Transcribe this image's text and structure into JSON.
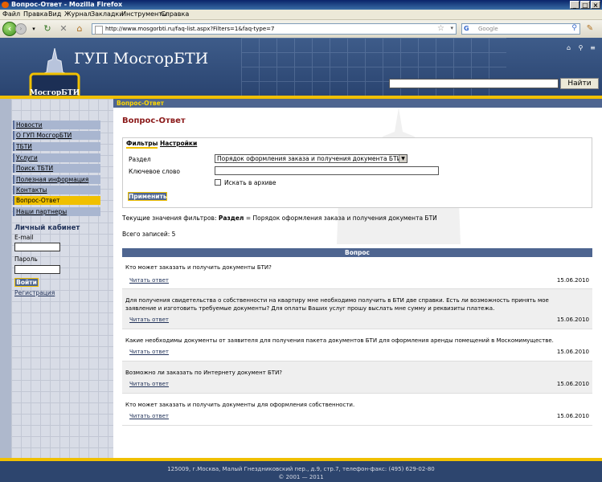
{
  "window": {
    "title": "Вопрос-Ответ - Mozilla Firefox",
    "buttons": [
      "_",
      "□",
      "×"
    ]
  },
  "menu": [
    "Файл",
    "Правка",
    "Вид",
    "Журнал",
    "Закладки",
    "Инструменты",
    "Справка"
  ],
  "browser": {
    "url": "http://www.mosgorbti.ru/faq-list.aspx?Filters=1&faq-type=7",
    "search_placeholder": "Google",
    "search_engine_icon": "G"
  },
  "site": {
    "title": "ГУП МосгорБТИ",
    "emblem_text": "МосгорБТИ",
    "search_button": "Найти"
  },
  "breadcrumb": "Вопрос-Ответ",
  "sidebar": {
    "items": [
      {
        "label": "Новости",
        "active": false
      },
      {
        "label": "О ГУП МосгорБТИ",
        "active": false
      },
      {
        "label": "ТБТИ",
        "active": false
      },
      {
        "label": "Услуги",
        "active": false
      },
      {
        "label": "Поиск ТБТИ",
        "active": false
      },
      {
        "label": "Полезная информация",
        "active": false
      },
      {
        "label": "Контакты",
        "active": false
      },
      {
        "label": "Вопрос-Ответ",
        "active": true
      },
      {
        "label": "Наши партнеры",
        "active": false
      }
    ],
    "cabinet_title": "Личный кабинет",
    "email_label": "E-mail",
    "password_label": "Пароль",
    "login_button": "Войти",
    "register_link": "Регистрация"
  },
  "main": {
    "page_title": "Вопрос-Ответ",
    "tabs": [
      "Фильтры",
      "Настройки"
    ],
    "filters": {
      "section_label": "Раздел",
      "section_value": "Порядок оформления заказа и получения документа БТИ",
      "keyword_label": "Ключевое слово",
      "keyword_value": "",
      "archive_label": "Искать в архиве",
      "apply_button": "Применить"
    },
    "current_filters_prefix": "Текущие значения фильтров:",
    "current_filters_key": "Раздел",
    "current_filters_value": "= Порядок оформления заказа и получения документа БТИ",
    "total": "Всего записей: 5",
    "table_header": "Вопрос",
    "read_label": "Читать ответ",
    "questions": [
      {
        "text": "Кто может заказать и получить документы БТИ?",
        "date": "15.06.2010"
      },
      {
        "text": "Для получения свидетельства о собственности на квартиру мне необходимо получить в БТИ две справки. Есть ли возможность принять мое заявление и изготовить требуемые документы? Для оплаты Ваших услуг прошу выслать мне сумму и реквизиты платежа.",
        "date": "15.06.2010"
      },
      {
        "text": "Какие необходимы документы от заявителя для получения пакета документов БТИ для оформления аренды помещений в Москомимуществе.",
        "date": "15.06.2010"
      },
      {
        "text": "Возможно ли заказать по Интернету документ БТИ?",
        "date": "15.06.2010"
      },
      {
        "text": "Кто может заказать и получить документы для оформления собственности.",
        "date": "15.06.2010"
      }
    ]
  },
  "footer": {
    "address": "125009, г.Москва, Малый Гнездниковский пер., д.9, стр.7, телефон-факс: (495) 629-02-80",
    "copyright": "© 2001 — 2011"
  },
  "colors": {
    "header_blue": "#3e5c8a",
    "accent_yellow": "#f0c000",
    "nav_blue": "#4e6590",
    "title_red": "#8b1a1a"
  }
}
